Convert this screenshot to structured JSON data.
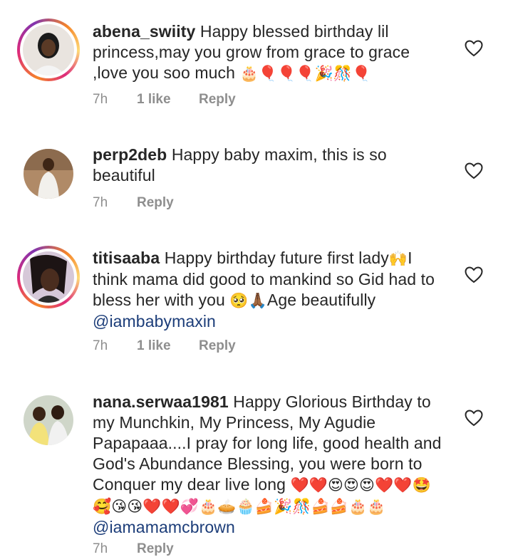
{
  "comments": [
    {
      "username": "abena_swiity",
      "text": "Happy blessed birthday lil princess,may you grow from grace to grace ,love you soo much",
      "emoji": "🎂🎈🎈🎈🎉🎊🎈",
      "time": "7h",
      "likes": "1 like",
      "reply": "Reply"
    },
    {
      "username": "perp2deb",
      "text": "Happy baby maxim, this is so beautiful",
      "time": "7h",
      "reply": "Reply"
    },
    {
      "username": "titisaaba",
      "text": "Happy birthday future first lady",
      "emoji1": "🙌",
      "text2": "I think mama did good to mankind so Gid had to bless her with you",
      "emoji2": "🥺🙏🏾",
      "text3": "Age beautifully",
      "mention": "@iambabymaxin",
      "time": "7h",
      "likes": "1 like",
      "reply": "Reply"
    },
    {
      "username": "nana.serwaa1981",
      "text": "Happy Glorious Birthday to my Munchkin,  My Princess, My Agudie Papapaaa....I pray for long life,  good health and God's Abundance Blessing, you were born to Conquer my dear live long",
      "emoji": "❤️❤️😍😍😍❤️❤️🤩🥰😘😘❤️❤️💞🎂🥧🧁🍰🎉🎊🍰🍰🎂🎂",
      "mention": "@iamamamcbrown",
      "time": "7h",
      "reply": "Reply"
    }
  ],
  "colors": {
    "text": "#262626",
    "meta": "#8e8e8e",
    "mention": "#1c3d79"
  },
  "icons": {
    "like": "heart-outline-icon"
  }
}
